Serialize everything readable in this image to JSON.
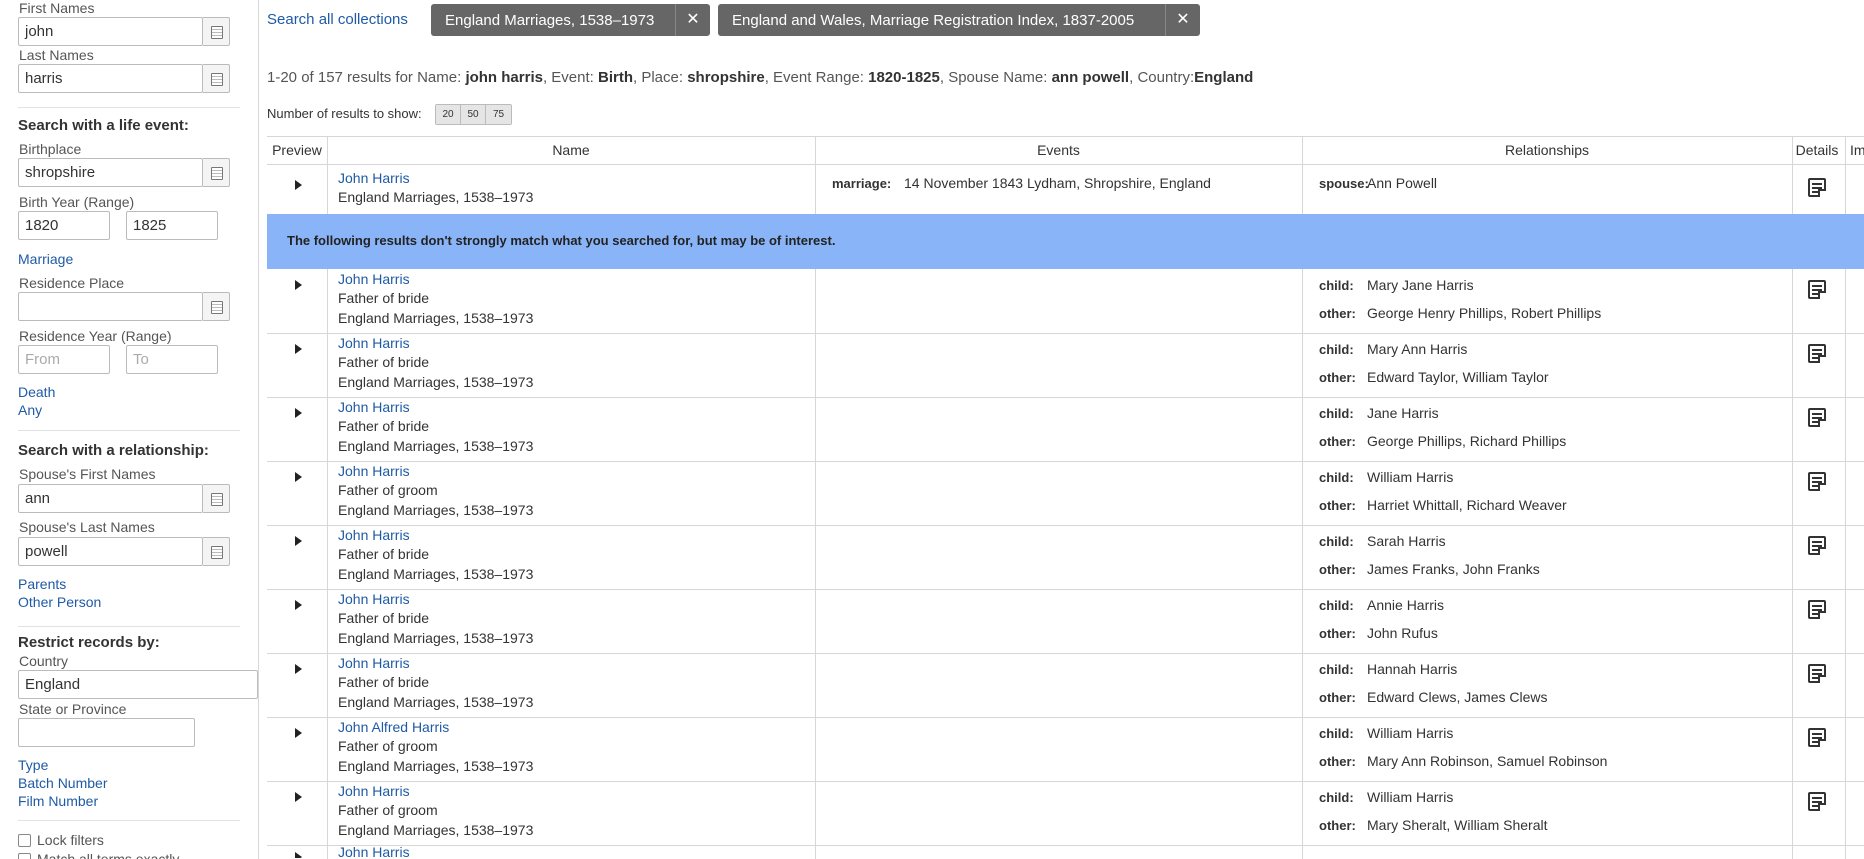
{
  "sidebar": {
    "first_names_label": "First Names",
    "first_names_value": "john",
    "last_names_label": "Last Names",
    "last_names_value": "harris",
    "life_event_heading": "Search with a life event:",
    "birthplace_label": "Birthplace",
    "birthplace_value": "shropshire",
    "birth_year_label": "Birth Year (Range)",
    "birth_year_from": "1820",
    "birth_year_to": "1825",
    "marriage_link": "Marriage",
    "residence_place_label": "Residence Place",
    "residence_year_label": "Residence Year (Range)",
    "residence_from_placeholder": "From",
    "residence_to_placeholder": "To",
    "death_link": "Death",
    "any_link": "Any",
    "relationship_heading": "Search with a relationship:",
    "spouse_first_label": "Spouse's First Names",
    "spouse_first_value": "ann",
    "spouse_last_label": "Spouse's Last Names",
    "spouse_last_value": "powell",
    "parents_link": "Parents",
    "other_person_link": "Other Person",
    "restrict_heading": "Restrict records by:",
    "country_label": "Country",
    "country_value": "England",
    "state_label": "State or Province",
    "type_link": "Type",
    "batch_link": "Batch Number",
    "film_link": "Film Number",
    "lock_filters_label": "Lock filters",
    "match_all_label": "Match all terms exactly"
  },
  "header": {
    "search_all": "Search all collections",
    "chip1": "England Marriages, 1538–1973",
    "chip2": "England and Wales, Marriage Registration Index, 1837-2005",
    "close_glyph": "✕"
  },
  "summary": {
    "prefix": "1-20 of 157 results for Name: ",
    "name": "john harris",
    "event_label": ", Event: ",
    "event": "Birth",
    "place_label": ", Place: ",
    "place": "shropshire",
    "range_label": ", Event Range: ",
    "range": "1820-1825",
    "spouse_label": ", Spouse Name: ",
    "spouse": "ann powell",
    "country_label": ", Country:",
    "country": "England"
  },
  "num_results": {
    "label": "Number of results to show:",
    "options": [
      "20",
      "50",
      "75"
    ]
  },
  "table": {
    "headers": {
      "preview": "Preview",
      "name": "Name",
      "events": "Events",
      "relationships": "Relationships",
      "details": "Details",
      "images": "Im"
    },
    "top_row": {
      "name": "John Harris",
      "collection": "England Marriages, 1538–1973",
      "event_type": "marriage:",
      "event_value": "14 November 1843   Lydham, Shropshire, England",
      "rel_key": "spouse:",
      "rel_value": "Ann Powell"
    },
    "banner": "The following results don't strongly match what you searched for, but may be of interest.",
    "rows": [
      {
        "name": "John Harris",
        "role": "Father of bride",
        "collection": "England Marriages, 1538–1973",
        "child_key": "child:",
        "child": "Mary Jane Harris",
        "other_key": "other:",
        "other": "George Henry Phillips, Robert Phillips"
      },
      {
        "name": "John Harris",
        "role": "Father of bride",
        "collection": "England Marriages, 1538–1973",
        "child_key": "child:",
        "child": "Mary Ann Harris",
        "other_key": "other:",
        "other": "Edward Taylor, William Taylor"
      },
      {
        "name": "John Harris",
        "role": "Father of bride",
        "collection": "England Marriages, 1538–1973",
        "child_key": "child:",
        "child": "Jane Harris",
        "other_key": "other:",
        "other": "George Phillips, Richard Phillips"
      },
      {
        "name": "John Harris",
        "role": "Father of groom",
        "collection": "England Marriages, 1538–1973",
        "child_key": "child:",
        "child": "William Harris",
        "other_key": "other:",
        "other": "Harriet Whittall, Richard Weaver"
      },
      {
        "name": "John Harris",
        "role": "Father of bride",
        "collection": "England Marriages, 1538–1973",
        "child_key": "child:",
        "child": "Sarah Harris",
        "other_key": "other:",
        "other": "James Franks, John Franks"
      },
      {
        "name": "John Harris",
        "role": "Father of bride",
        "collection": "England Marriages, 1538–1973",
        "child_key": "child:",
        "child": "Annie Harris",
        "other_key": "other:",
        "other": "John Rufus"
      },
      {
        "name": "John Harris",
        "role": "Father of bride",
        "collection": "England Marriages, 1538–1973",
        "child_key": "child:",
        "child": "Hannah Harris",
        "other_key": "other:",
        "other": "Edward Clews, James Clews"
      },
      {
        "name": "John Alfred Harris",
        "role": "Father of groom",
        "collection": "England Marriages, 1538–1973",
        "child_key": "child:",
        "child": "William Harris",
        "other_key": "other:",
        "other": "Mary Ann Robinson, Samuel Robinson"
      },
      {
        "name": "John Harris",
        "role": "Father of groom",
        "collection": "England Marriages, 1538–1973",
        "child_key": "child:",
        "child": "William Harris",
        "other_key": "other:",
        "other": "Mary Sheralt, William Sheralt"
      }
    ],
    "partial_row_name": "John Harris"
  }
}
